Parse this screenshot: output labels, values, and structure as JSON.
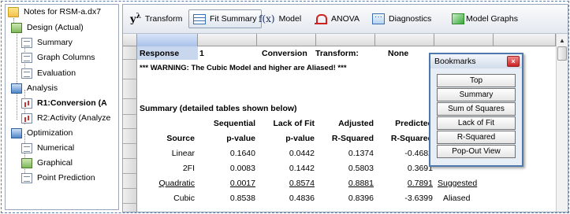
{
  "tree": {
    "root": "Notes for RSM-a.dx7",
    "design": "Design (Actual)",
    "summary": "Summary",
    "graph_columns": "Graph Columns",
    "evaluation": "Evaluation",
    "analysis": "Analysis",
    "r1": "R1:Conversion (A",
    "r2": "R2:Activity (Analyze",
    "optimization": "Optimization",
    "numerical": "Numerical",
    "graphical": "Graphical",
    "point_prediction": "Point Prediction"
  },
  "toolbar": {
    "transform": "Transform",
    "fit_summary": "Fit Summary",
    "model": "Model",
    "anova": "ANOVA",
    "diagnostics": "Diagnostics",
    "model_graphs": "Model Graphs",
    "y_icon": "y",
    "y_sup": "λ",
    "fx_icon": "f(x)"
  },
  "report": {
    "response_label": "Response",
    "response_num": "1",
    "response_name": "Conversion",
    "transform_label": "Transform:",
    "transform_value": "None",
    "warning": "*** WARNING:  The Cubic Model and higher are Aliased! ***",
    "summary_title": "Summary (detailed tables shown below)",
    "col_h1": [
      "Sequential",
      "Lack of Fit",
      "Adjusted",
      "Predicted"
    ],
    "col_h2": [
      "Source",
      "p-value",
      "p-value",
      "R-Squared",
      "R-Squared"
    ],
    "rows": [
      {
        "source": "Linear",
        "seq": "0.1640",
        "lof": "0.0442",
        "adj": "0.1374",
        "pred": "-0.4682",
        "note": ""
      },
      {
        "source": "2FI",
        "seq": "0.0083",
        "lof": "0.1442",
        "adj": "0.5803",
        "pred": "0.3691",
        "note": ""
      },
      {
        "source": "Quadratic",
        "seq": "0.0017",
        "lof": "0.8574",
        "adj": "0.8881",
        "pred": "0.7891",
        "note": "Suggested"
      },
      {
        "source": "Cubic",
        "seq": "0.8538",
        "lof": "0.4836",
        "adj": "0.8396",
        "pred": "-3.6399",
        "note": "Aliased"
      }
    ]
  },
  "bookmarks": {
    "title": "Bookmarks",
    "close": "×",
    "items": [
      "Top",
      "Summary",
      "Sum of Squares",
      "Lack of Fit",
      "R-Squared",
      "Pop-Out View"
    ]
  }
}
